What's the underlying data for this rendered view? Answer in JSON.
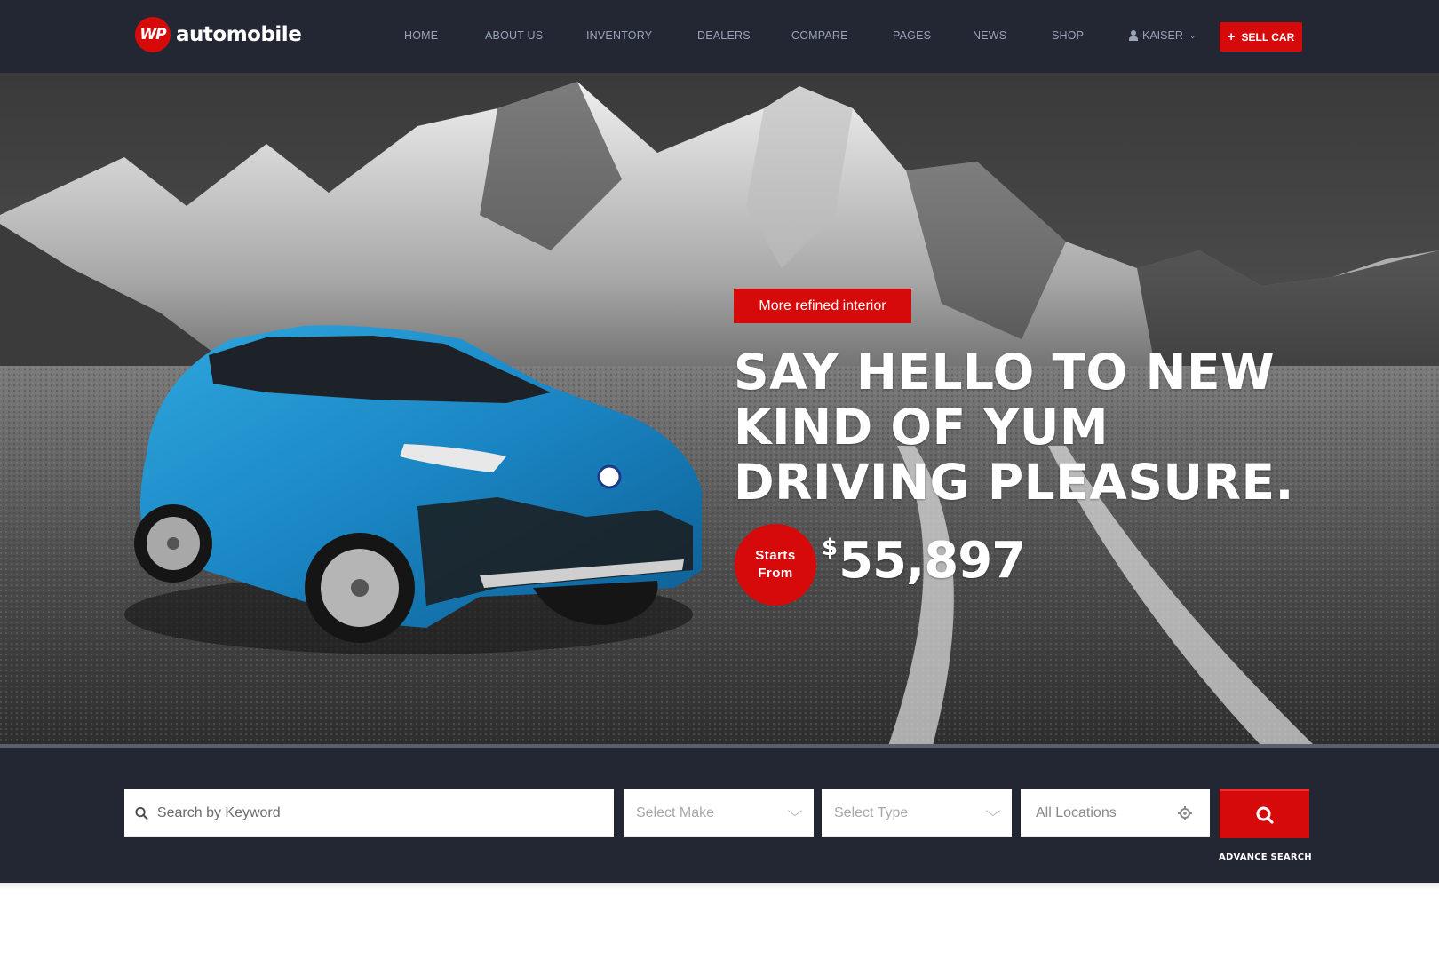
{
  "brand": {
    "badge": "WP",
    "name": "automobile",
    "accent_color": "#d60a0a"
  },
  "nav": {
    "items": [
      {
        "label": "HOME"
      },
      {
        "label": "ABOUT US"
      },
      {
        "label": "INVENTORY"
      },
      {
        "label": "DEALERS"
      },
      {
        "label": "COMPARE"
      },
      {
        "label": "PAGES"
      },
      {
        "label": "NEWS"
      },
      {
        "label": "SHOP"
      }
    ],
    "user": {
      "label": "KAISER",
      "icon": "user-icon"
    },
    "sell_button": {
      "label": "SELL CAR",
      "icon": "plus-icon"
    }
  },
  "hero": {
    "tag": "More refined interior",
    "headline": [
      "SAY HELLO TO NEW",
      "KIND OF YUM",
      "DRIVING PLEASURE."
    ],
    "price_badge": [
      "Starts",
      "From"
    ],
    "price_currency": "$",
    "price_value": "55,897"
  },
  "search": {
    "keyword_placeholder": "Search by Keyword",
    "make_label": "Select Make",
    "type_label": "Select Type",
    "location_label": "All Locations",
    "advance_search_label": "ADVANCE SEARCH"
  }
}
